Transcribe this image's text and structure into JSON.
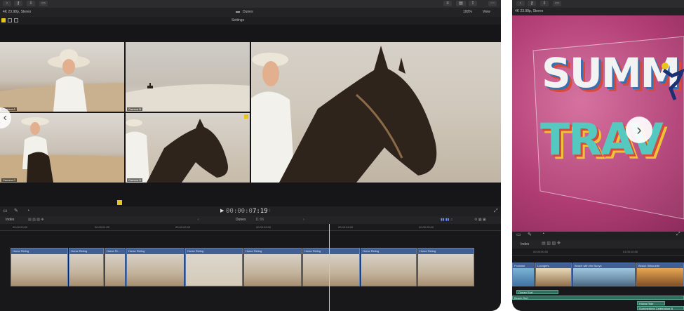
{
  "left": {
    "header": {
      "library": "4K 23.98p, Stereo",
      "project": "Dunes",
      "zoom": "100%",
      "view": "View"
    },
    "subbar": {
      "settings": "Settings"
    },
    "angles": [
      {
        "label": "Camera A"
      },
      {
        "label": "Camera B"
      },
      {
        "label": "Camera C"
      },
      {
        "label": "Camera D"
      }
    ],
    "transport": {
      "timecode_dim": "00:00:0",
      "timecode_bright": "7:19"
    },
    "timeline": {
      "index": "Index",
      "project": "Dunes",
      "duration": "11:06",
      "ruler": [
        "00:00:00:00",
        "00:00:01:00",
        "00:00:02:00",
        "00:00:03:00",
        "00:00:04:00",
        "00:00:05:00",
        "00:00:06:00"
      ],
      "clips": [
        "Horse Riding",
        "Horse Riding",
        "Horse Ri...",
        "Horse Riding",
        "Horse Riding",
        "Horse Riding",
        "Horse Riding",
        "Horse Riding",
        "Horse Riding",
        "Horse Riding"
      ]
    }
  },
  "right": {
    "header": {
      "library": "4K 23.98p, Stereo"
    },
    "title_text": [
      "SUMM",
      "TRAV"
    ],
    "timeline": {
      "index": "Index",
      "ruler": [
        "00:00:00:00",
        "01:00:10:00"
      ],
      "clips": [
        "Poolside",
        "Loungers",
        "Beach with the Buoys",
        "Beach Silhouette"
      ],
      "green_bars": [
        "Ocean Surf",
        "Beach Surf",
        "Hiking Ride",
        "Summertime Celebration B"
      ]
    }
  }
}
